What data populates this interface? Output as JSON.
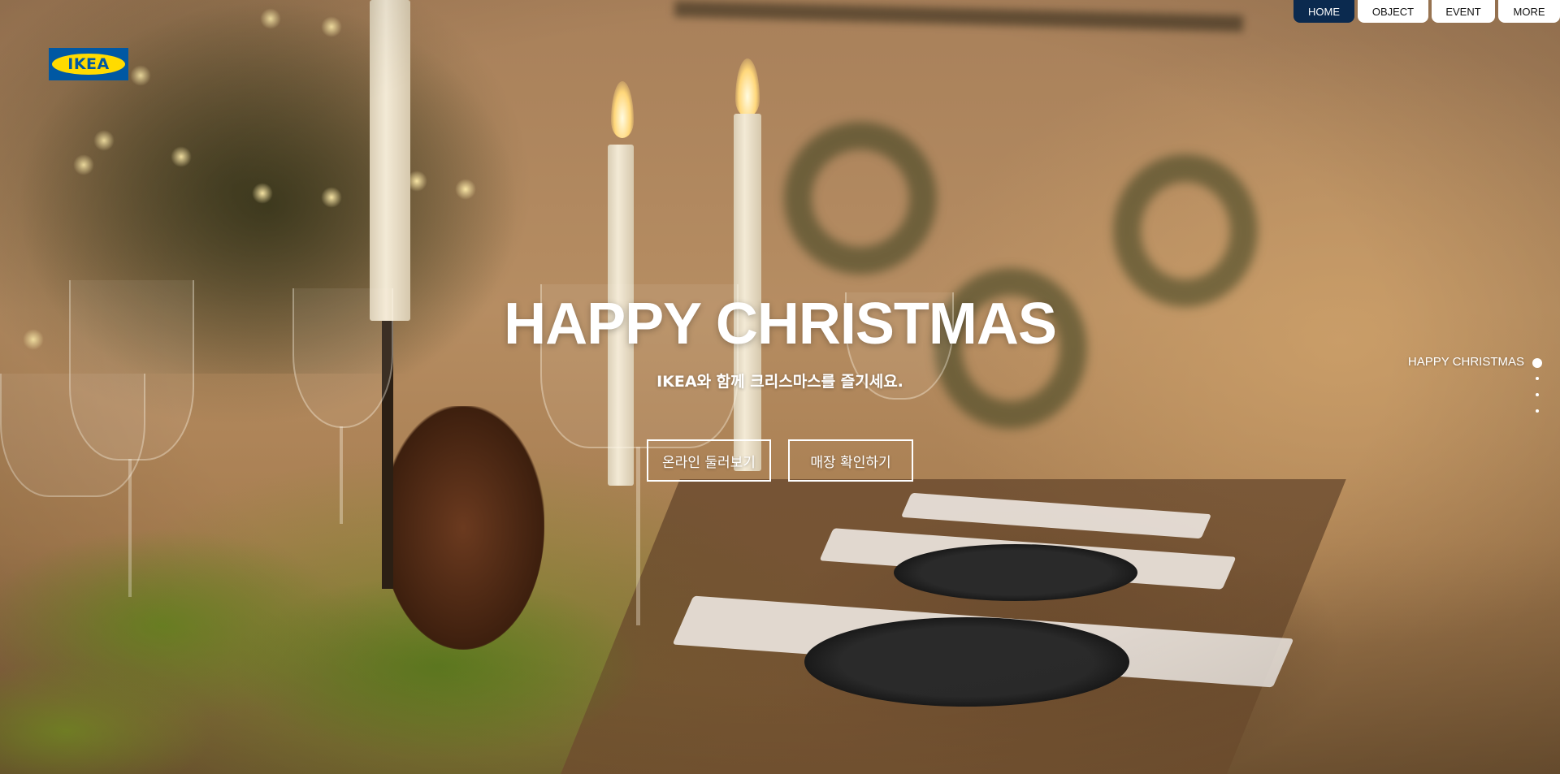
{
  "brand": {
    "logo_text": "IKEA",
    "logo_blue": "#0058a3",
    "logo_yellow": "#ffdb00"
  },
  "nav": {
    "items": [
      {
        "label": "HOME",
        "active": true
      },
      {
        "label": "OBJECT",
        "active": false
      },
      {
        "label": "EVENT",
        "active": false
      },
      {
        "label": "MORE",
        "active": false
      }
    ],
    "active_color": "#0b2a4f"
  },
  "hero": {
    "title": "HAPPY CHRISTMAS",
    "subtitle": "IKEA와 함께 크리스마스를 즐기세요.",
    "buttons": [
      {
        "label": "온라인 둘러보기"
      },
      {
        "label": "매장 확인하기"
      }
    ]
  },
  "pager": {
    "current_label": "HAPPY CHRISTMAS",
    "total": 4,
    "current_index": 1
  }
}
